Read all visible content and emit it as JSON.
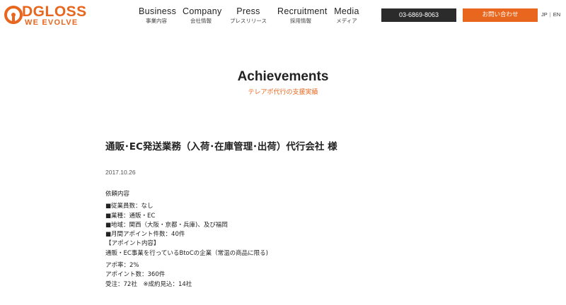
{
  "header": {
    "logo_text": "DGLOSS",
    "logo_tagline": "WE EVOLVE",
    "nav": [
      {
        "en": "Business",
        "jp": "事業内容"
      },
      {
        "en": "Company",
        "jp": "会社情報"
      },
      {
        "en": "Press",
        "jp": "プレスリリース"
      },
      {
        "en": "Recruitment",
        "jp": "採用情報"
      },
      {
        "en": "Media",
        "jp": "メディア"
      }
    ],
    "phone": "03-6869-8063",
    "contact_label": "お問い合わせ",
    "lang_jp": "JP",
    "lang_sep": "|",
    "lang_en": "EN"
  },
  "section": {
    "title": "Achievements",
    "subtitle": "テレアポ代行の支援実績"
  },
  "article": {
    "title": "通販･EC発送業務（入荷･在庫管理･出荷）代行会社 様",
    "date": "2017.10.26",
    "body": {
      "request_heading": "依頼内容",
      "details": [
        "■従業員数：なし",
        "■業種：通販・EC",
        "■地域：関西（大阪・京都・兵庫)、及び福岡",
        "■月間アポイント件数：40件"
      ],
      "appointment_heading": "【アポイント内容】",
      "appointment_target": "通販・EC事業を行っているBtoCの企業（常温の商品に限る)",
      "results": [
        "アポ率：2%",
        "アポイント数：360件",
        "受注：72社　※成約見込：14社"
      ]
    }
  },
  "colors": {
    "brand_orange": "#e8661d",
    "dark_button": "#2b2b2b"
  }
}
